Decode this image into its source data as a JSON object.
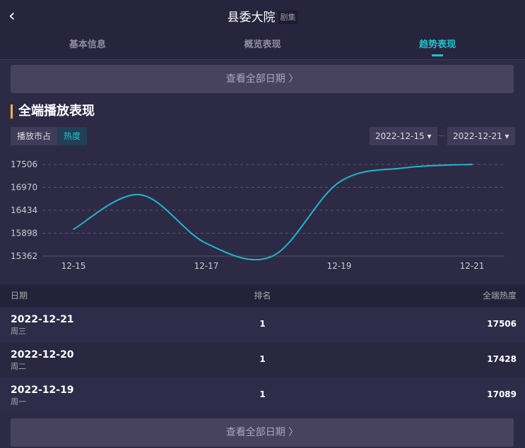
{
  "header": {
    "title": "县委大院",
    "tag": "剧集"
  },
  "tabs": [
    "基本信息",
    "概览表现",
    "趋势表现"
  ],
  "view_all": "查看全部日期 〉",
  "section_title": "全端播放表现",
  "segments": [
    "播放市占",
    "热度"
  ],
  "date_from": "2022-12-15 ▾",
  "date_to": "2022-12-21 ▾",
  "chart_data": {
    "type": "line",
    "x": [
      "12-15",
      "12-16",
      "12-17",
      "12-18",
      "12-19",
      "12-20",
      "12-21"
    ],
    "x_tick_labels": [
      "12-15",
      "12-17",
      "12-19",
      "12-21"
    ],
    "values": [
      15990,
      16797,
      15659,
      15366,
      17089,
      17428,
      17506
    ],
    "y_ticks": [
      "15362",
      "15898",
      "16434",
      "16970",
      "17506"
    ],
    "ylim": [
      15362,
      17506
    ],
    "color": "#1fb8c9"
  },
  "table": {
    "headers": [
      "日期",
      "排名",
      "全端热度"
    ],
    "rows": [
      {
        "date": "2022-12-21",
        "weekday": "周三",
        "rank": "1",
        "heat": "17506"
      },
      {
        "date": "2022-12-20",
        "weekday": "周二",
        "rank": "1",
        "heat": "17428"
      },
      {
        "date": "2022-12-19",
        "weekday": "周一",
        "rank": "1",
        "heat": "17089"
      }
    ]
  }
}
